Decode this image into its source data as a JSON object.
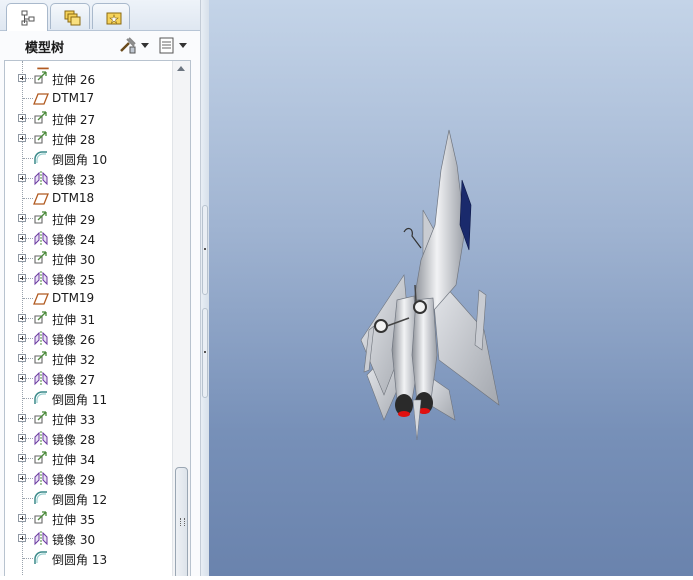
{
  "tabs": [
    {
      "name": "model-tree-tab",
      "icon": "model-tree-icon"
    },
    {
      "name": "folder-browser-tab",
      "icon": "folder-icon"
    },
    {
      "name": "favorites-tab",
      "icon": "favorites-folder-icon"
    }
  ],
  "header": {
    "title": "模型树",
    "tools_icon": "settings-tools-icon",
    "columns_icon": "tree-columns-icon"
  },
  "tree_items": [
    {
      "label": "拉伸 26",
      "type": "extrude",
      "expandable": true
    },
    {
      "label": "DTM17",
      "type": "datum-plane",
      "expandable": false
    },
    {
      "label": "拉伸 27",
      "type": "extrude",
      "expandable": true
    },
    {
      "label": "拉伸 28",
      "type": "extrude",
      "expandable": true
    },
    {
      "label": "倒圆角 10",
      "type": "round",
      "expandable": false
    },
    {
      "label": "镜像 23",
      "type": "mirror",
      "expandable": true
    },
    {
      "label": "DTM18",
      "type": "datum-plane",
      "expandable": false
    },
    {
      "label": "拉伸 29",
      "type": "extrude",
      "expandable": true
    },
    {
      "label": "镜像 24",
      "type": "mirror",
      "expandable": true
    },
    {
      "label": "拉伸 30",
      "type": "extrude",
      "expandable": true
    },
    {
      "label": "镜像 25",
      "type": "mirror",
      "expandable": true
    },
    {
      "label": "DTM19",
      "type": "datum-plane",
      "expandable": false
    },
    {
      "label": "拉伸 31",
      "type": "extrude",
      "expandable": true
    },
    {
      "label": "镜像 26",
      "type": "mirror",
      "expandable": true
    },
    {
      "label": "拉伸 32",
      "type": "extrude",
      "expandable": true
    },
    {
      "label": "镜像 27",
      "type": "mirror",
      "expandable": true
    },
    {
      "label": "倒圆角 11",
      "type": "round",
      "expandable": false
    },
    {
      "label": "拉伸 33",
      "type": "extrude",
      "expandable": true
    },
    {
      "label": "镜像 28",
      "type": "mirror",
      "expandable": true
    },
    {
      "label": "拉伸 34",
      "type": "extrude",
      "expandable": true
    },
    {
      "label": "镜像 29",
      "type": "mirror",
      "expandable": true
    },
    {
      "label": "倒圆角 12",
      "type": "round",
      "expandable": false
    },
    {
      "label": "拉伸 35",
      "type": "extrude",
      "expandable": true
    },
    {
      "label": "镜像 30",
      "type": "mirror",
      "expandable": true
    },
    {
      "label": "倒圆角 13",
      "type": "round",
      "expandable": false
    }
  ],
  "viewport": {
    "content": "jet-fighter-3d-model"
  }
}
